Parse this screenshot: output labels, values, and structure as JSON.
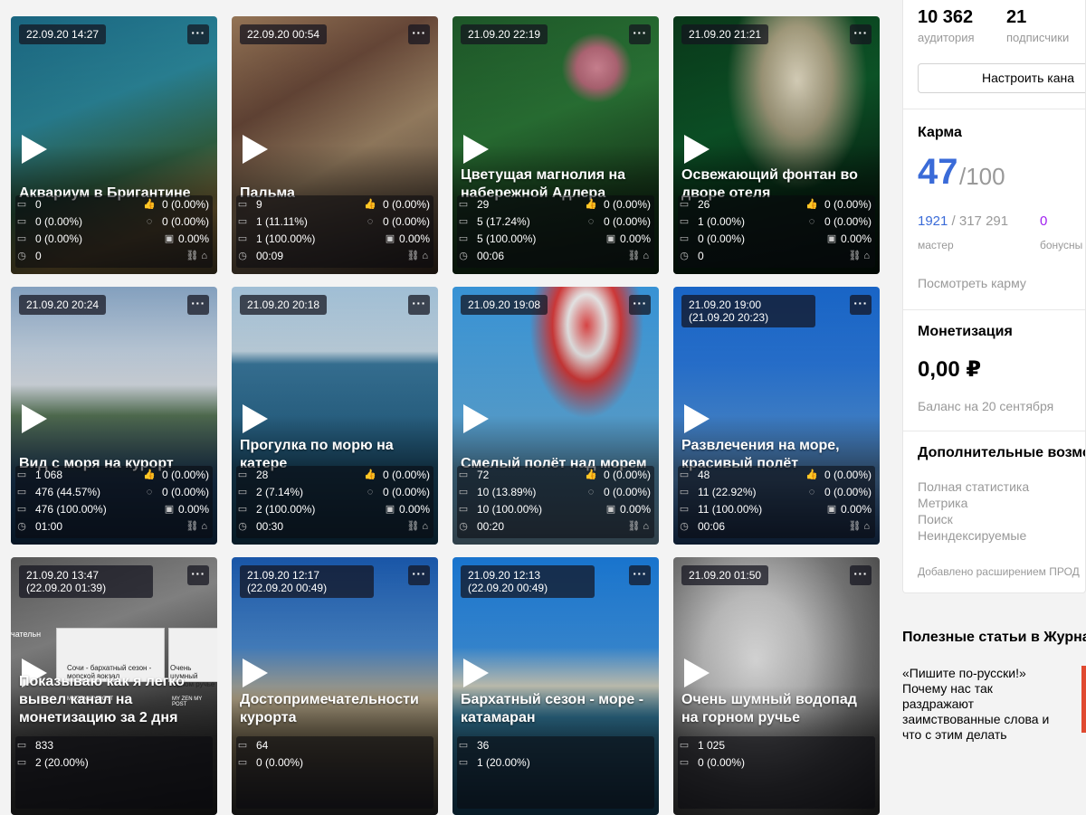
{
  "cards": [
    {
      "date": "22.09.20 14:27",
      "title": "Аквариум в Бригантине",
      "stats": {
        "views": "0",
        "reads": "0 (0.00%)",
        "finish": "0 (0.00%)",
        "time": "0",
        "likes": "0 (0.00%)",
        "comments": "0 (0.00%)",
        "ctr": "0.00%"
      },
      "bg": "linear-gradient(160deg,#1b6a86 0%,#2c8a9e 35%,#356b4a 60%,#a88a4a 80%,#6b5a3a 100%)"
    },
    {
      "date": "22.09.20 00:54",
      "title": "Пальма",
      "stats": {
        "views": "9",
        "reads": "1 (11.11%)",
        "finish": "1 (100.00%)",
        "time": "00:09",
        "likes": "0 (0.00%)",
        "comments": "0 (0.00%)",
        "ctr": "0.00%"
      },
      "bg": "linear-gradient(150deg,#9b7a5a 0%,#6b4a3a 30%,#a58a6a 55%,#7a6550 80%,#4d3a2a 100%)"
    },
    {
      "date": "21.09.20 22:19",
      "title": "Цветущая магнолия на набережной Адлера",
      "stats": {
        "views": "29",
        "reads": "5 (17.24%)",
        "finish": "5 (100.00%)",
        "time": "00:06",
        "likes": "0 (0.00%)",
        "comments": "0 (0.00%)",
        "ctr": "0.00%"
      },
      "bg": "radial-gradient(circle at 70% 20%,#d88a9a 0%,#b86a7a 8%,transparent 14%),linear-gradient(160deg,#1f5a2a 0%,#2c7a38 40%,#1d4a22 70%,#0f2f14 100%)"
    },
    {
      "date": "21.09.20 21:21",
      "title": "Освежающий фонтан во дворе отеля",
      "stats": {
        "views": "26",
        "reads": "1 (0.00%)",
        "finish": "0 (0.00%)",
        "time": "0",
        "likes": "0 (0.00%)",
        "comments": "0 (0.00%)",
        "ctr": "0.00%"
      },
      "bg": "radial-gradient(ellipse at 60% 25%,#e8e0c8 0%,#a8a080 20%,transparent 40%),linear-gradient(160deg,#0a3a1a 0%,#0d5a2a 40%,#083018 70%,#041a0c 100%)"
    },
    {
      "date": "21.09.20 20:24",
      "title": "Вид с моря на курорт",
      "stats": {
        "views": "1 068",
        "reads": "476 (44.57%)",
        "finish": "476 (100.00%)",
        "time": "01:00",
        "likes": "0 (0.00%)",
        "comments": "0 (0.00%)",
        "ctr": "0.00%"
      },
      "bg": "linear-gradient(180deg,#8aa8c8 0%,#c8d8e8 25%,#dfe6ee 38%,#5a7a5a 50%,#4a6a6a 62%,#2a5a8a 75%,#1a4a7a 100%)"
    },
    {
      "date": "21.09.20 20:18",
      "title": "Прогулка по морю на катере",
      "stats": {
        "views": "28",
        "reads": "2 (7.14%)",
        "finish": "2 (100.00%)",
        "time": "00:30",
        "likes": "0 (0.00%)",
        "comments": "0 (0.00%)",
        "ctr": "0.00%"
      },
      "bg": "linear-gradient(180deg,#a8c8e0 0%,#c8dcea 25%,#3a7aa0 30%,#2a6a90 60%,#1a5a80 100%)"
    },
    {
      "date": "21.09.20 19:08",
      "title": "Смелый полёт над морем",
      "stats": {
        "views": "72",
        "reads": "10 (13.89%)",
        "finish": "10 (100.00%)",
        "time": "00:20",
        "likes": "0 (0.00%)",
        "comments": "0 (0.00%)",
        "ctr": "0.00%"
      },
      "bg": "radial-gradient(ellipse at 65% 15%,#e84a4a 0%,#f0f0f0 10%,#d83a3a 18%,transparent 30%),linear-gradient(180deg,#3a9ae0 0%,#5ab0ea 45%,#7ac4f0 80%,#a0d4f4 100%)"
    },
    {
      "date": "21.09.20 19:00\n(21.09.20 20:23)",
      "title": "Развлечения на море, красивый полёт",
      "stats": {
        "views": "48",
        "reads": "11 (22.92%)",
        "finish": "11 (100.00%)",
        "time": "00:06",
        "likes": "0 (0.00%)",
        "comments": "0 (0.00%)",
        "ctr": "0.00%"
      },
      "bg": "linear-gradient(180deg,#1a6ad0 0%,#2a7ae0 30%,#4a94e6 55%,#6aa8ea 75%,#2a5a9a 100%)"
    },
    {
      "date": "21.09.20 13:47\n(22.09.20 01:39)",
      "title": "Показываю как я легко вывел канал на монетизацию за 2 дня",
      "stats": {
        "views": "833",
        "reads": "2 (20.00%)"
      },
      "bg": "linear-gradient(160deg,#5a5a5a 0%,#8a8a8a 30%,#4a4a4a 60%,#2a2a2a 100%)",
      "thumbs": [
        "Сочи - бархатный сезон - морской вокзал",
        "Очень шумный горном ручье",
        "MY ZEN MY POST",
        "MY ZEN MY POST",
        "чательн"
      ]
    },
    {
      "date": "21.09.20 12:17\n(22.09.20 00:49)",
      "title": "Достопримечательности курорта",
      "stats": {
        "views": "64",
        "reads": "0 (0.00%)"
      },
      "bg": "linear-gradient(180deg,#1a5ab0 0%,#4a8ad0 35%,#c8b898 55%,#8a7a5a 75%,#3a3a3a 100%)"
    },
    {
      "date": "21.09.20 12:13\n(22.09.20 00:49)",
      "title": "Бархатный сезон - море - катамаран",
      "stats": {
        "views": "36",
        "reads": "1 (20.00%)"
      },
      "bg": "linear-gradient(180deg,#1a7ad8 0%,#3a94e6 35%,#d8d8c8 50%,#3a8ab0 62%,#1a5a80 100%)"
    },
    {
      "date": "21.09.20 01:50",
      "title": "Очень шумный водопад на горном ручье",
      "stats": {
        "views": "1 025",
        "reads": "0 (0.00%)"
      },
      "bg": "radial-gradient(ellipse at 40% 40%,#f0f0f0 0%,#c8c8c8 30%,#7a7a7a 60%,#3a3a3a 100%)"
    }
  ],
  "sidebar": {
    "audience_value": "10 362",
    "audience_label": "аудитория",
    "subs_value": "21",
    "subs_label": "подписчики",
    "setup_btn": "Настроить кана",
    "karma_title": "Карма",
    "karma_value": "47",
    "karma_of": "/100",
    "master_value": "1921",
    "master_of": " / 317 291",
    "master_label": "мастер",
    "bonus_value": "0",
    "bonus_label": "бонусны",
    "karma_link": "Посмотреть карму",
    "money_title": "Монетизация",
    "money_value": "0,00 ₽",
    "money_label": "Баланс на 20 сентября",
    "extra_title": "Дополнительные возмо",
    "extra_items": [
      "Полная статистика",
      "Метрика",
      "Поиск",
      "Неиндексируемые"
    ],
    "extension_note": "Добавлено расширением ПРОД"
  },
  "articles": {
    "title": "Полезные статьи в Журна",
    "item": "«Пишите по-русски!» Почему нас так раздражают заимствованные слова и что с этим делать"
  },
  "colors": {
    "karma": "#3a6bd8",
    "master": "#3a6bd8",
    "bonus": "#a020f0"
  }
}
